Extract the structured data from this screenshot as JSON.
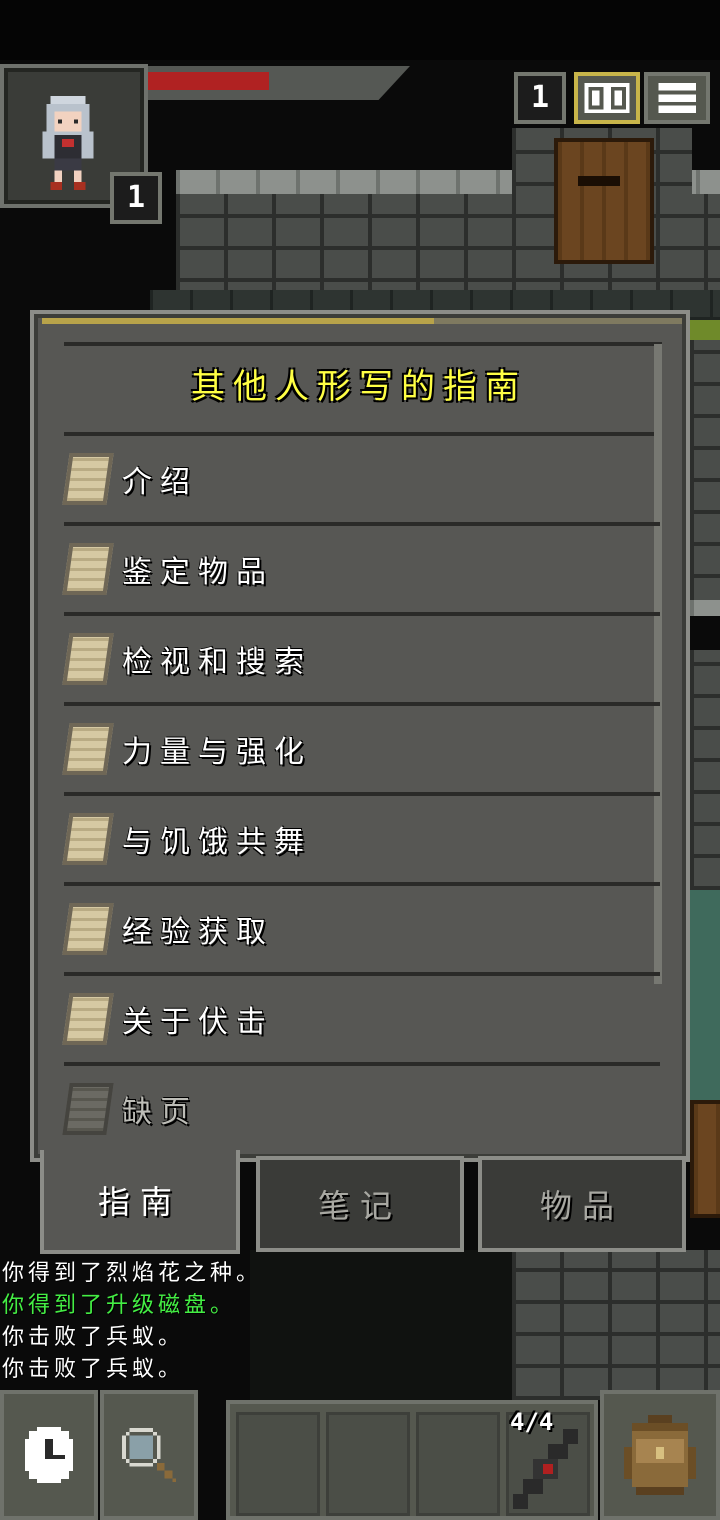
{
  "hud": {
    "hero_level": "1",
    "depth": "1",
    "hp_fraction": 0.46,
    "hp_color": "#b02222"
  },
  "hud_buttons": {
    "journal_icon": "journal-icon",
    "menu_icon": "menu-icon"
  },
  "window": {
    "title": "其他人形写的指南",
    "entries": [
      {
        "label": "介绍",
        "icon": "document-page-icon",
        "read": true
      },
      {
        "label": "鉴定物品",
        "icon": "document-page-icon",
        "read": true
      },
      {
        "label": "检视和搜索",
        "icon": "document-page-icon",
        "read": true
      },
      {
        "label": "力量与强化",
        "icon": "document-page-icon",
        "read": true
      },
      {
        "label": "与饥饿共舞",
        "icon": "document-page-icon",
        "read": true
      },
      {
        "label": "经验获取",
        "icon": "document-page-icon",
        "read": true
      },
      {
        "label": "关于伏击",
        "icon": "document-page-icon",
        "read": true
      },
      {
        "label": "缺页",
        "icon": "document-page-icon",
        "read": false
      }
    ]
  },
  "tabs": [
    {
      "label": "指南",
      "active": true
    },
    {
      "label": "笔记",
      "active": false
    },
    {
      "label": "物品",
      "active": false
    }
  ],
  "log": [
    {
      "text": "你得到了烈焰花之种。",
      "color": "#ffffff"
    },
    {
      "text": "你得到了升级磁盘。",
      "color": "#44ee44"
    },
    {
      "text": "你击败了兵蚁。",
      "color": "#ffffff"
    },
    {
      "text": "你击败了兵蚁。",
      "color": "#ffffff"
    }
  ],
  "toolbar": {
    "wait_icon": "clock-icon",
    "search_icon": "magnifier-icon",
    "ammo": "4/4",
    "backpack_icon": "backpack-icon"
  }
}
